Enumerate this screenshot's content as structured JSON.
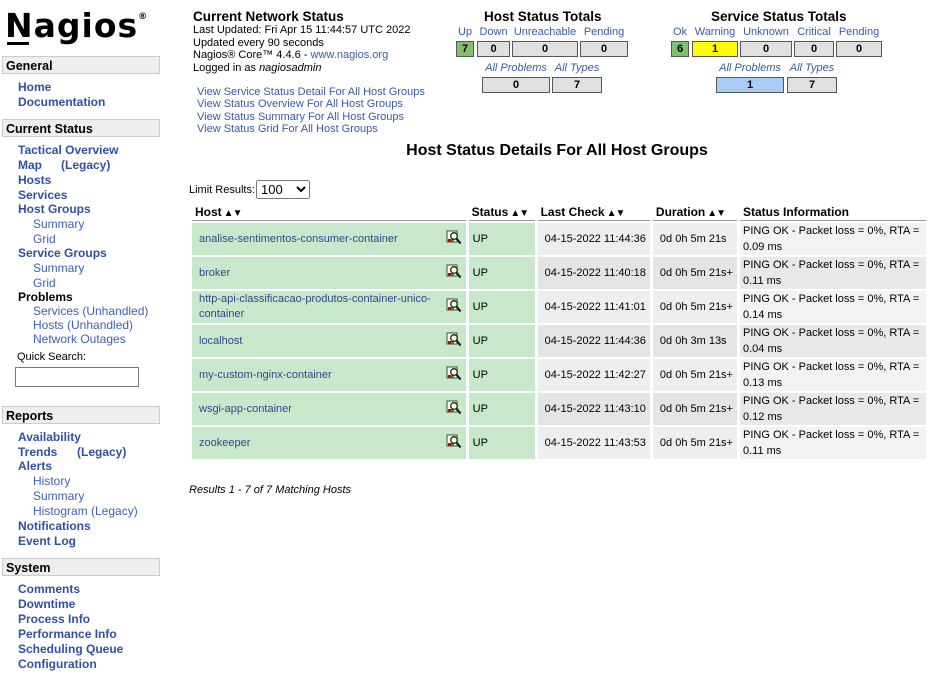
{
  "app": {
    "logo": "Nagios",
    "reg": "®"
  },
  "sidebar": {
    "general": {
      "title": "General",
      "items": [
        "Home",
        "Documentation"
      ]
    },
    "current_status": {
      "title": "Current Status",
      "tactical": "Tactical Overview",
      "map": "Map",
      "map_legacy": "(Legacy)",
      "hosts": "Hosts",
      "services": "Services",
      "host_groups": "Host Groups",
      "hg_summary": "Summary",
      "hg_grid": "Grid",
      "service_groups": "Service Groups",
      "sg_summary": "Summary",
      "sg_grid": "Grid",
      "problems": "Problems",
      "services_unhandled": "Services (Unhandled)",
      "hosts_unhandled": "Hosts (Unhandled)",
      "network_outages": "Network Outages",
      "quick_search_label": "Quick Search:",
      "quick_search_value": ""
    },
    "reports": {
      "title": "Reports",
      "availability": "Availability",
      "trends": "Trends",
      "trends_legacy": "(Legacy)",
      "alerts": "Alerts",
      "history": "History",
      "summary": "Summary",
      "histogram": "Histogram (Legacy)",
      "notifications": "Notifications",
      "event_log": "Event Log"
    },
    "system": {
      "title": "System",
      "items": [
        "Comments",
        "Downtime",
        "Process Info",
        "Performance Info",
        "Scheduling Queue",
        "Configuration"
      ]
    }
  },
  "network_status": {
    "title": "Current Network Status",
    "last_updated": "Last Updated: Fri Apr 15 11:44:57 UTC 2022",
    "update_interval": "Updated every 90 seconds",
    "version_prefix": "Nagios® Core™ 4.4.6 - ",
    "version_link": "www.nagios.org",
    "logged_prefix": "Logged in as ",
    "logged_user": "nagiosadmin",
    "links": [
      "View Service Status Detail For All Host Groups",
      "View Status Overview For All Host Groups",
      "View Status Summary For All Host Groups",
      "View Status Grid For All Host Groups"
    ]
  },
  "host_totals": {
    "title": "Host Status Totals",
    "labels": [
      "Up",
      "Down",
      "Unreachable",
      "Pending"
    ],
    "values": [
      "7",
      "0",
      "0",
      "0"
    ],
    "all_problems_label": "All Problems",
    "all_types_label": "All Types",
    "all_problems": "0",
    "all_types": "7"
  },
  "service_totals": {
    "title": "Service Status Totals",
    "labels": [
      "Ok",
      "Warning",
      "Unknown",
      "Critical",
      "Pending"
    ],
    "values": [
      "6",
      "1",
      "0",
      "0",
      "0"
    ],
    "all_problems_label": "All Problems",
    "all_types_label": "All Types",
    "all_problems": "1",
    "all_types": "7"
  },
  "main": {
    "title": "Host Status Details For All Host Groups",
    "limit_label": "Limit Results:",
    "limit_value": "100",
    "columns": [
      "Host",
      "Status",
      "Last Check",
      "Duration",
      "Status Information"
    ],
    "rows": [
      {
        "host": "analise-sentimentos-consumer-container",
        "status": "UP",
        "last_check": "04-15-2022 11:44:36",
        "duration": "0d 0h 5m 21s",
        "info": "PING OK - Packet loss = 0%, RTA = 0.09 ms"
      },
      {
        "host": "broker",
        "status": "UP",
        "last_check": "04-15-2022 11:40:18",
        "duration": "0d 0h 5m 21s+",
        "info": "PING OK - Packet loss = 0%, RTA = 0.11 ms"
      },
      {
        "host": "http-api-classificacao-produtos-container-unico-container",
        "status": "UP",
        "last_check": "04-15-2022 11:41:01",
        "duration": "0d 0h 5m 21s+",
        "info": "PING OK - Packet loss = 0%, RTA = 0.14 ms"
      },
      {
        "host": "localhost",
        "status": "UP",
        "last_check": "04-15-2022 11:44:36",
        "duration": "0d 0h 3m 13s",
        "info": "PING OK - Packet loss = 0%, RTA = 0.04 ms"
      },
      {
        "host": "my-custom-nginx-container",
        "status": "UP",
        "last_check": "04-15-2022 11:42:27",
        "duration": "0d 0h 5m 21s+",
        "info": "PING OK - Packet loss = 0%, RTA = 0.13 ms"
      },
      {
        "host": "wsgi-app-container",
        "status": "UP",
        "last_check": "04-15-2022 11:43:10",
        "duration": "0d 0h 5m 21s+",
        "info": "PING OK - Packet loss = 0%, RTA = 0.12 ms"
      },
      {
        "host": "zookeeper",
        "status": "UP",
        "last_check": "04-15-2022 11:43:53",
        "duration": "0d 0h 5m 21s+",
        "info": "PING OK - Packet loss = 0%, RTA = 0.11 ms"
      }
    ],
    "results_text": "Results 1 - 7 of 7 Matching Hosts"
  },
  "colors": {
    "ok_green": "#80c070",
    "warning_yellow": "#ffff00",
    "problem_blue": "#a9cdf5",
    "row_green": "#c8e8cc",
    "link_blue": "#3050a0"
  },
  "icons": {
    "sort": "sort-arrows-icon",
    "host_detail": "magnifier-icon"
  }
}
